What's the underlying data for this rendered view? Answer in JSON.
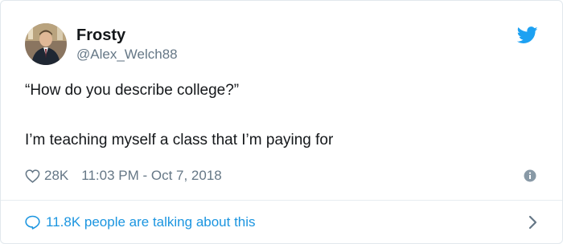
{
  "author": {
    "display_name": "Frosty",
    "handle": "@Alex_Welch88"
  },
  "tweet": {
    "lines": [
      "“How do you describe college?”",
      "I’m teaching myself a class that I’m paying for"
    ]
  },
  "stats": {
    "likes": "28K",
    "timestamp": "11:03 PM - Oct 7, 2018"
  },
  "footer": {
    "conversation_label": "11.8K people are talking about this"
  },
  "icons": {
    "brand": "twitter-bird-icon",
    "like": "heart-outline-icon",
    "info": "info-circle-icon",
    "reply": "speech-bubble-icon",
    "chevron": "chevron-right-icon"
  },
  "colors": {
    "brand_blue": "#1da1f2",
    "link_blue": "#1b95e0",
    "text": "#14171a",
    "muted": "#657786",
    "border": "#e1e8ed"
  }
}
